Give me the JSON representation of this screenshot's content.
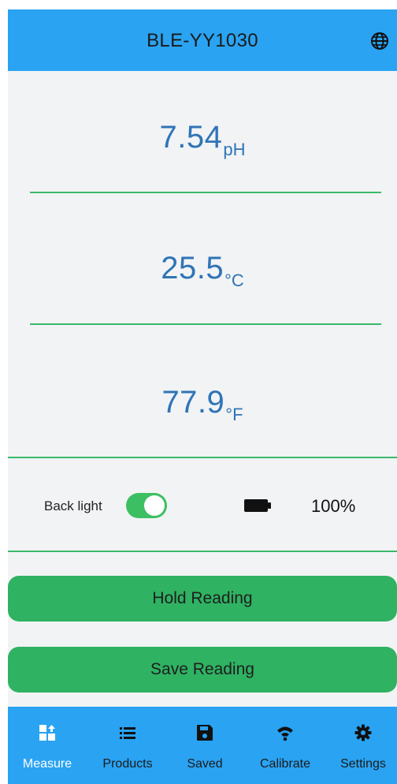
{
  "header": {
    "title": "BLE-YY1030",
    "language_icon": "globe-icon"
  },
  "readings": [
    {
      "value": "7.54",
      "unit": "pH"
    },
    {
      "value": "25.5",
      "unit": "°C"
    },
    {
      "value": "77.9",
      "unit": "°F"
    }
  ],
  "status": {
    "backlight_label": "Back light",
    "backlight_on": true,
    "battery_icon": "battery-full-icon",
    "battery_percent": "100%"
  },
  "actions": {
    "hold_label": "Hold Reading",
    "save_label": "Save Reading"
  },
  "tabs": [
    {
      "label": "Measure",
      "icon": "measure-icon",
      "active": true
    },
    {
      "label": "Products",
      "icon": "list-icon",
      "active": false
    },
    {
      "label": "Saved",
      "icon": "floppy-disk-icon",
      "active": false
    },
    {
      "label": "Calibrate",
      "icon": "wifi-signal-icon",
      "active": false
    },
    {
      "label": "Settings",
      "icon": "gear-icon",
      "active": false
    }
  ],
  "colors": {
    "header_bg": "#2aa3f2",
    "reading_text": "#2f74b6",
    "divider": "#3bb86a",
    "button_bg": "#2fb262",
    "toggle_on": "#3cbf62"
  }
}
